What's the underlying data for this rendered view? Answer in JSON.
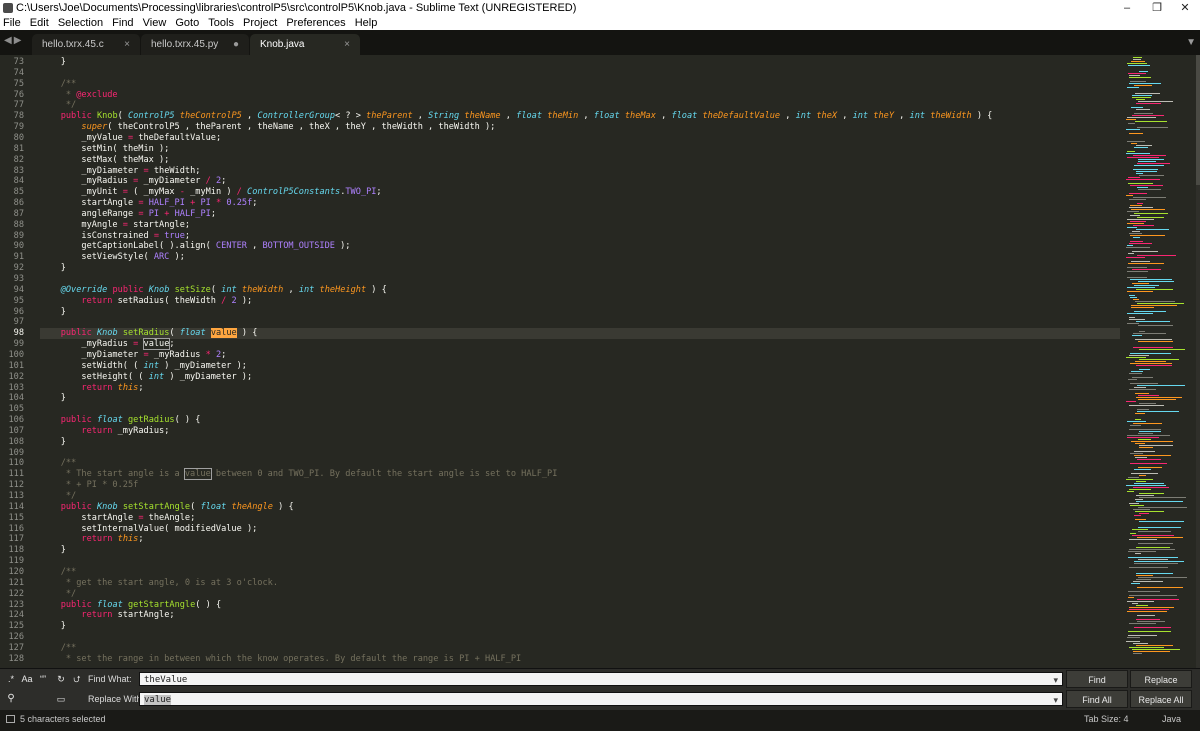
{
  "window": {
    "title": "C:\\Users\\Joe\\Documents\\Processing\\libraries\\controlP5\\src\\controlP5\\Knob.java - Sublime Text (UNREGISTERED)",
    "controls": [
      "–",
      "❐",
      "✕"
    ]
  },
  "menu": [
    "File",
    "Edit",
    "Selection",
    "Find",
    "View",
    "Goto",
    "Tools",
    "Project",
    "Preferences",
    "Help"
  ],
  "tabs": [
    {
      "label": "hello.txrx.45.c",
      "marker": "×",
      "active": false
    },
    {
      "label": "hello.txrx.45.py",
      "marker": "●",
      "active": false
    },
    {
      "label": "Knob.java",
      "marker": "×",
      "active": true
    }
  ],
  "editor": {
    "first_line_number": 73,
    "current_line": 98,
    "lines": [
      [
        [
          "    }",
          ""
        ]
      ],
      [
        [
          "",
          ""
        ]
      ],
      [
        [
          "    /**",
          "c"
        ]
      ],
      [
        [
          "     * ",
          "c"
        ],
        [
          "@exclude",
          "k"
        ]
      ],
      [
        [
          "     */",
          "c"
        ]
      ],
      [
        [
          "    ",
          ""
        ],
        [
          "public",
          "k"
        ],
        [
          " ",
          ""
        ],
        [
          "Knob",
          "f"
        ],
        [
          "( ",
          ""
        ],
        [
          "ControlP5",
          "t"
        ],
        [
          " ",
          ""
        ],
        [
          "theControlP5",
          "p"
        ],
        [
          " , ",
          ""
        ],
        [
          "ControllerGroup",
          "t"
        ],
        [
          "< ? > ",
          ""
        ],
        [
          "theParent",
          "p"
        ],
        [
          " , ",
          ""
        ],
        [
          "String",
          "t"
        ],
        [
          " ",
          ""
        ],
        [
          "theName",
          "p"
        ],
        [
          " , ",
          ""
        ],
        [
          "float",
          "t"
        ],
        [
          " ",
          ""
        ],
        [
          "theMin",
          "p"
        ],
        [
          " , ",
          ""
        ],
        [
          "float",
          "t"
        ],
        [
          " ",
          ""
        ],
        [
          "theMax",
          "p"
        ],
        [
          " , ",
          ""
        ],
        [
          "float",
          "t"
        ],
        [
          " ",
          ""
        ],
        [
          "theDefaultValue",
          "p"
        ],
        [
          " , ",
          ""
        ],
        [
          "int",
          "t"
        ],
        [
          " ",
          ""
        ],
        [
          "theX",
          "p"
        ],
        [
          " , ",
          ""
        ],
        [
          "int",
          "t"
        ],
        [
          " ",
          ""
        ],
        [
          "theY",
          "p"
        ],
        [
          " , ",
          ""
        ],
        [
          "int",
          "t"
        ],
        [
          " ",
          ""
        ],
        [
          "theWidth",
          "p"
        ],
        [
          " ) {",
          ""
        ]
      ],
      [
        [
          "        ",
          ""
        ],
        [
          "super",
          "p"
        ],
        [
          "( theControlP5 , theParent , theName , theX , theY , theWidth , theWidth );",
          ""
        ]
      ],
      [
        [
          "        _myValue ",
          ""
        ],
        [
          "=",
          "k"
        ],
        [
          " theDefaultValue;",
          ""
        ]
      ],
      [
        [
          "        setMin( theMin );",
          ""
        ]
      ],
      [
        [
          "        setMax( theMax );",
          ""
        ]
      ],
      [
        [
          "        _myDiameter ",
          ""
        ],
        [
          "=",
          "k"
        ],
        [
          " theWidth;",
          ""
        ]
      ],
      [
        [
          "        _myRadius ",
          ""
        ],
        [
          "=",
          "k"
        ],
        [
          " _myDiameter ",
          ""
        ],
        [
          "/",
          "k"
        ],
        [
          " ",
          ""
        ],
        [
          "2",
          "n"
        ],
        [
          ";",
          ""
        ]
      ],
      [
        [
          "        _myUnit ",
          ""
        ],
        [
          "=",
          "k"
        ],
        [
          " ( _myMax ",
          ""
        ],
        [
          "-",
          "k"
        ],
        [
          " _myMin ) ",
          ""
        ],
        [
          "/",
          "k"
        ],
        [
          " ",
          ""
        ],
        [
          "ControlP5Constants",
          "t"
        ],
        [
          ".",
          ""
        ],
        [
          "TWO_PI",
          "n"
        ],
        [
          ";",
          ""
        ]
      ],
      [
        [
          "        startAngle ",
          ""
        ],
        [
          "=",
          "k"
        ],
        [
          " ",
          ""
        ],
        [
          "HALF_PI",
          "n"
        ],
        [
          " ",
          ""
        ],
        [
          "+",
          "k"
        ],
        [
          " ",
          ""
        ],
        [
          "PI",
          "n"
        ],
        [
          " ",
          ""
        ],
        [
          "*",
          "k"
        ],
        [
          " ",
          ""
        ],
        [
          "0.25f",
          "n"
        ],
        [
          ";",
          ""
        ]
      ],
      [
        [
          "        angleRange ",
          ""
        ],
        [
          "=",
          "k"
        ],
        [
          " ",
          ""
        ],
        [
          "PI",
          "n"
        ],
        [
          " ",
          ""
        ],
        [
          "+",
          "k"
        ],
        [
          " ",
          ""
        ],
        [
          "HALF_PI",
          "n"
        ],
        [
          ";",
          ""
        ]
      ],
      [
        [
          "        myAngle ",
          ""
        ],
        [
          "=",
          "k"
        ],
        [
          " startAngle;",
          ""
        ]
      ],
      [
        [
          "        isConstrained ",
          ""
        ],
        [
          "=",
          "k"
        ],
        [
          " ",
          ""
        ],
        [
          "true",
          "n"
        ],
        [
          ";",
          ""
        ]
      ],
      [
        [
          "        getCaptionLabel( ).align( ",
          ""
        ],
        [
          "CENTER",
          "n"
        ],
        [
          " , ",
          ""
        ],
        [
          "BOTTOM_OUTSIDE",
          "n"
        ],
        [
          " );",
          ""
        ]
      ],
      [
        [
          "        setViewStyle( ",
          ""
        ],
        [
          "ARC",
          "n"
        ],
        [
          " );",
          ""
        ]
      ],
      [
        [
          "    }",
          ""
        ]
      ],
      [
        [
          "",
          ""
        ]
      ],
      [
        [
          "    ",
          ""
        ],
        [
          "@Override",
          "ann"
        ],
        [
          " ",
          ""
        ],
        [
          "public",
          "k"
        ],
        [
          " ",
          ""
        ],
        [
          "Knob",
          "t"
        ],
        [
          " ",
          ""
        ],
        [
          "setSize",
          "f"
        ],
        [
          "( ",
          ""
        ],
        [
          "int",
          "t"
        ],
        [
          " ",
          ""
        ],
        [
          "theWidth",
          "p"
        ],
        [
          " , ",
          ""
        ],
        [
          "int",
          "t"
        ],
        [
          " ",
          ""
        ],
        [
          "theHeight",
          "p"
        ],
        [
          " ) {",
          ""
        ]
      ],
      [
        [
          "        ",
          ""
        ],
        [
          "return",
          "k"
        ],
        [
          " setRadius( theWidth ",
          ""
        ],
        [
          "/",
          "k"
        ],
        [
          " ",
          ""
        ],
        [
          "2",
          "n"
        ],
        [
          " );",
          ""
        ]
      ],
      [
        [
          "    }",
          ""
        ]
      ],
      [
        [
          "",
          ""
        ]
      ],
      [
        [
          "    ",
          ""
        ],
        [
          "public",
          "k"
        ],
        [
          " ",
          ""
        ],
        [
          "Knob",
          "t"
        ],
        [
          " ",
          ""
        ],
        [
          "setRadius",
          "f"
        ],
        [
          "( ",
          ""
        ],
        [
          "float",
          "t"
        ],
        [
          " ",
          ""
        ],
        [
          "value",
          "sel"
        ],
        [
          " ) {",
          ""
        ]
      ],
      [
        [
          "        _myRadius ",
          ""
        ],
        [
          "=",
          "k"
        ],
        [
          " ",
          ""
        ],
        [
          "value",
          "box"
        ],
        [
          ";",
          ""
        ]
      ],
      [
        [
          "        _myDiameter ",
          ""
        ],
        [
          "=",
          "k"
        ],
        [
          " _myRadius ",
          ""
        ],
        [
          "*",
          "k"
        ],
        [
          " ",
          ""
        ],
        [
          "2",
          "n"
        ],
        [
          ";",
          ""
        ]
      ],
      [
        [
          "        setWidth( ( ",
          ""
        ],
        [
          "int",
          "t"
        ],
        [
          " ) _myDiameter );",
          ""
        ]
      ],
      [
        [
          "        setHeight( ( ",
          ""
        ],
        [
          "int",
          "t"
        ],
        [
          " ) _myDiameter );",
          ""
        ]
      ],
      [
        [
          "        ",
          ""
        ],
        [
          "return",
          "k"
        ],
        [
          " ",
          ""
        ],
        [
          "this",
          "p"
        ],
        [
          ";",
          ""
        ]
      ],
      [
        [
          "    }",
          ""
        ]
      ],
      [
        [
          "",
          ""
        ]
      ],
      [
        [
          "    ",
          ""
        ],
        [
          "public",
          "k"
        ],
        [
          " ",
          ""
        ],
        [
          "float",
          "t"
        ],
        [
          " ",
          ""
        ],
        [
          "getRadius",
          "f"
        ],
        [
          "( ) {",
          ""
        ]
      ],
      [
        [
          "        ",
          ""
        ],
        [
          "return",
          "k"
        ],
        [
          " _myRadius;",
          ""
        ]
      ],
      [
        [
          "    }",
          ""
        ]
      ],
      [
        [
          "",
          ""
        ]
      ],
      [
        [
          "    /**",
          "c"
        ]
      ],
      [
        [
          "     * The start angle is a ",
          "c"
        ],
        [
          "value",
          "box c"
        ],
        [
          " between 0 and TWO_PI. By default the start angle is set to HALF_PI",
          "c"
        ]
      ],
      [
        [
          "     * + PI * 0.25f",
          "c"
        ]
      ],
      [
        [
          "     */",
          "c"
        ]
      ],
      [
        [
          "    ",
          ""
        ],
        [
          "public",
          "k"
        ],
        [
          " ",
          ""
        ],
        [
          "Knob",
          "t"
        ],
        [
          " ",
          ""
        ],
        [
          "setStartAngle",
          "f"
        ],
        [
          "( ",
          ""
        ],
        [
          "float",
          "t"
        ],
        [
          " ",
          ""
        ],
        [
          "theAngle",
          "p"
        ],
        [
          " ) {",
          ""
        ]
      ],
      [
        [
          "        startAngle ",
          ""
        ],
        [
          "=",
          "k"
        ],
        [
          " theAngle;",
          ""
        ]
      ],
      [
        [
          "        setInternalValue( modifiedValue );",
          ""
        ]
      ],
      [
        [
          "        ",
          ""
        ],
        [
          "return",
          "k"
        ],
        [
          " ",
          ""
        ],
        [
          "this",
          "p"
        ],
        [
          ";",
          ""
        ]
      ],
      [
        [
          "    }",
          ""
        ]
      ],
      [
        [
          "",
          ""
        ]
      ],
      [
        [
          "    /**",
          "c"
        ]
      ],
      [
        [
          "     * get the start angle, 0 is at 3 o'clock.",
          "c"
        ]
      ],
      [
        [
          "     */",
          "c"
        ]
      ],
      [
        [
          "    ",
          ""
        ],
        [
          "public",
          "k"
        ],
        [
          " ",
          ""
        ],
        [
          "float",
          "t"
        ],
        [
          " ",
          ""
        ],
        [
          "getStartAngle",
          "f"
        ],
        [
          "( ) {",
          ""
        ]
      ],
      [
        [
          "        ",
          ""
        ],
        [
          "return",
          "k"
        ],
        [
          " startAngle;",
          ""
        ]
      ],
      [
        [
          "    }",
          ""
        ]
      ],
      [
        [
          "",
          ""
        ]
      ],
      [
        [
          "    /**",
          "c"
        ]
      ],
      [
        [
          "     * set the range in between which the know operates. By default the range is PI + HALF_PI",
          "c"
        ]
      ]
    ]
  },
  "find_panel": {
    "option_icons": [
      ".*",
      "Aa",
      "“”",
      "↻",
      "⮍"
    ],
    "find_label": "Find What:",
    "find_value": "theValue",
    "replace_label": "Replace With:",
    "replace_value": "value",
    "buttons": {
      "find": "Find",
      "replace": "Replace",
      "find_all": "Find All",
      "replace_all": "Replace All"
    }
  },
  "status": {
    "selection": "5 characters selected",
    "tab_size": "Tab Size: 4",
    "syntax": "Java"
  },
  "colors": {
    "background": "#272822",
    "keyword": "#f92672",
    "type": "#66d9ef",
    "function": "#a6e22e",
    "parameter": "#fd971f",
    "comment": "#75715e",
    "constant": "#ae81ff"
  }
}
